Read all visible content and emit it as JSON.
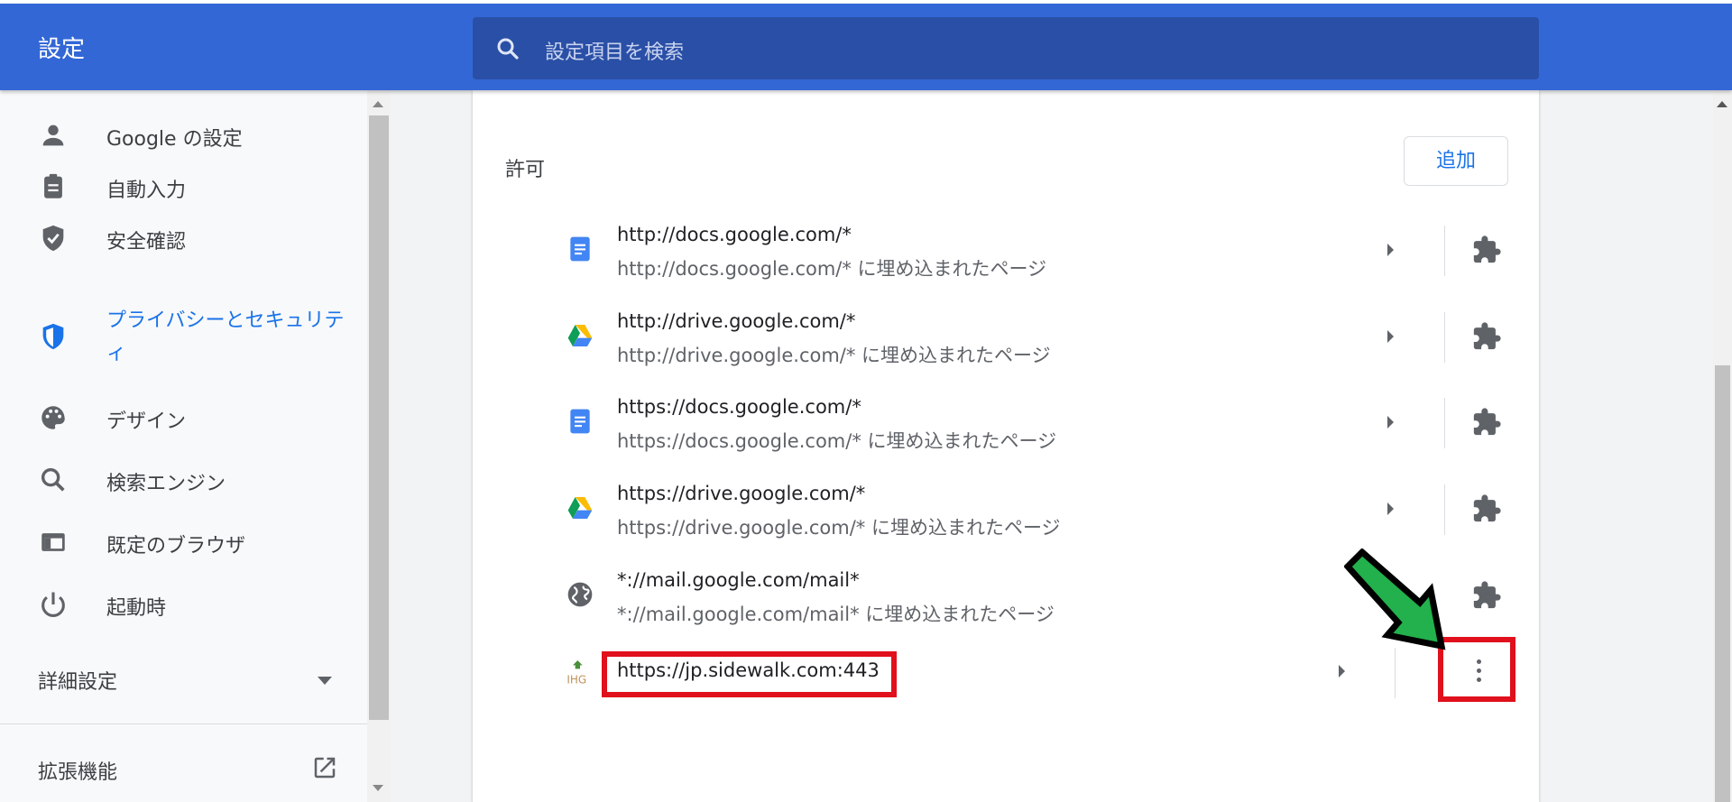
{
  "header": {
    "title": "設定",
    "search_placeholder": "設定項目を検索"
  },
  "sidebar": {
    "items": [
      {
        "label": "Google の設定",
        "icon": "person-icon"
      },
      {
        "label": "自動入力",
        "icon": "clipboard-icon"
      },
      {
        "label": "安全確認",
        "icon": "shield-check-icon"
      },
      {
        "label": "プライバシーとセキュリティ",
        "icon": "privacy-shield-icon",
        "active": true
      },
      {
        "label": "デザイン",
        "icon": "palette-icon"
      },
      {
        "label": "検索エンジン",
        "icon": "search-icon"
      },
      {
        "label": "既定のブラウザ",
        "icon": "browser-icon"
      },
      {
        "label": "起動時",
        "icon": "power-icon"
      }
    ],
    "advanced_label": "詳細設定",
    "extensions_label": "拡張機能"
  },
  "main": {
    "section_title": "許可",
    "add_label": "追加",
    "sites": [
      {
        "url": "http://docs.google.com/*",
        "sub": "http://docs.google.com/* に埋め込まれたページ",
        "icon": "google-docs-icon"
      },
      {
        "url": "http://drive.google.com/*",
        "sub": "http://drive.google.com/* に埋め込まれたページ",
        "icon": "google-drive-icon"
      },
      {
        "url": "https://docs.google.com/*",
        "sub": "https://docs.google.com/* に埋め込まれたページ",
        "icon": "google-docs-icon"
      },
      {
        "url": "https://drive.google.com/*",
        "sub": "https://drive.google.com/* に埋め込まれたページ",
        "icon": "google-drive-icon"
      },
      {
        "url": "*://mail.google.com/mail*",
        "sub": "*://mail.google.com/mail* に埋め込まれたページ",
        "icon": "globe-icon"
      },
      {
        "url": "https://jp.sidewalk.com:443",
        "sub": "",
        "icon": "site-favicon"
      }
    ]
  },
  "colors": {
    "header": "#3367d6",
    "accent": "#1a73e8",
    "highlight": "#e0101c",
    "annotation_arrow": "#22b14c"
  }
}
